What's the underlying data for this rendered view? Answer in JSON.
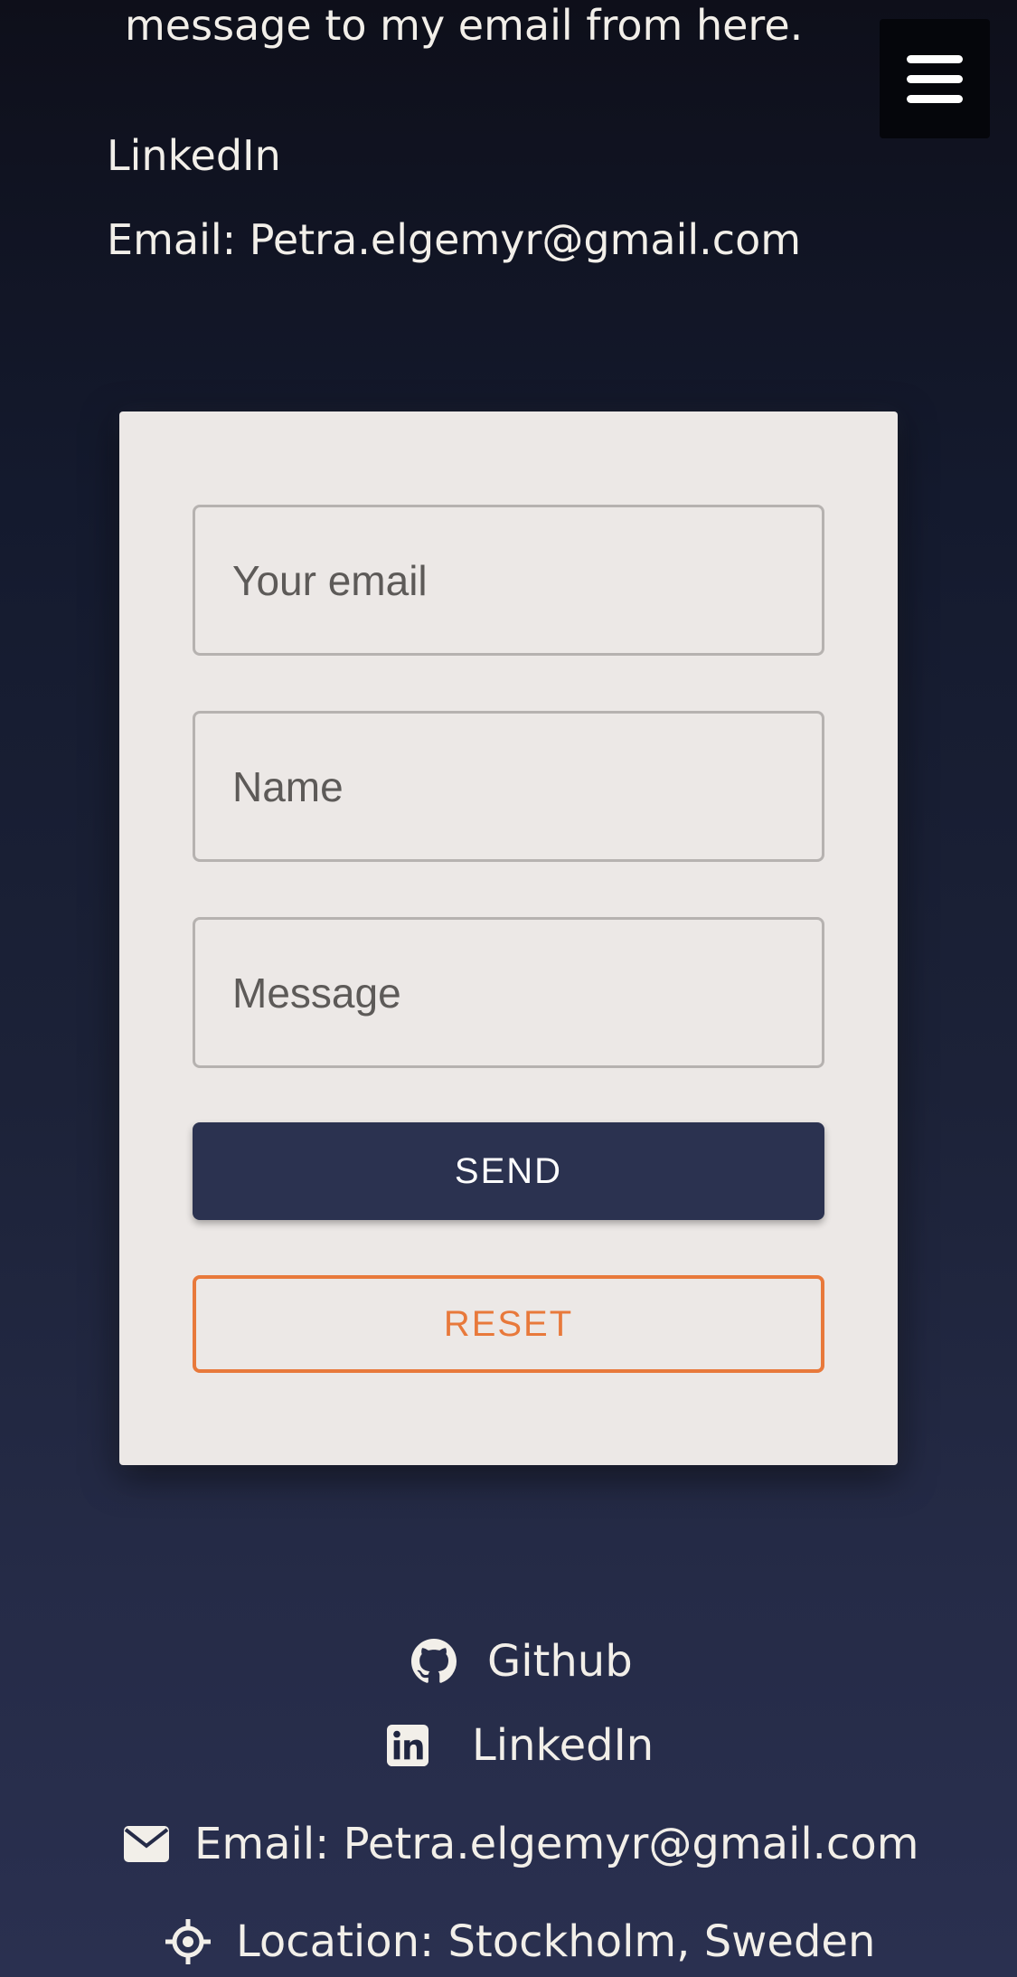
{
  "intro": {
    "text": "message to my email from here."
  },
  "menu": {
    "icon": "hamburger-menu-icon"
  },
  "top_links": {
    "linkedin": "LinkedIn",
    "email": "Email: Petra.elgemyr@gmail.com"
  },
  "form": {
    "email_placeholder": "Your email",
    "name_placeholder": "Name",
    "message_placeholder": "Message",
    "send_label": "SEND",
    "reset_label": "RESET"
  },
  "footer": {
    "github": {
      "label": "Github",
      "icon": "github-icon"
    },
    "linkedin": {
      "label": "LinkedIn",
      "icon": "linkedin-icon"
    },
    "email": {
      "label": "Email: Petra.elgemyr@gmail.com",
      "icon": "envelope-icon"
    },
    "location": {
      "label": "Location: Stockholm, Sweden",
      "icon": "crosshair-icon"
    }
  },
  "colors": {
    "send_button": "#2b3250",
    "reset_accent": "#e8793b",
    "card_background": "#ece8e6"
  }
}
